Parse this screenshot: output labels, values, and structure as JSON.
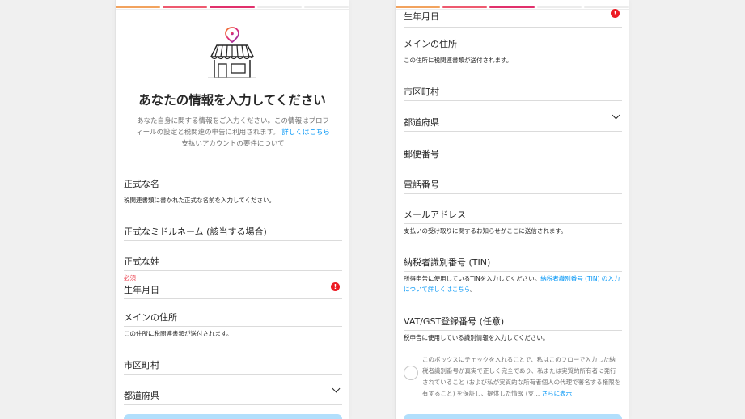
{
  "colors": {
    "progress": [
      "#f2a35e",
      "#ee5a6f",
      "#e1306c",
      "#ececec",
      "#ececec"
    ],
    "link": "#0095f6",
    "error": "#ed1c24",
    "button": "#b2dffc"
  },
  "left": {
    "title": "あなたの情報を入力してください",
    "intro": "あなた自身に関する情報をご入力ください。この情報はプロフィールの設定と税関連の申告に利用されます。",
    "intro_link": "詳しくはこちら",
    "intro_tail": " 支払いアカウントの要件について",
    "legal_first_name": "正式な名",
    "legal_first_name_help": "税関連書類に書かれた正式な名前を入力してください。",
    "middle_name": "正式なミドルネーム (該当する場合)",
    "last_name": "正式な姓",
    "required": "必須",
    "birthdate": "生年月日",
    "main_address": "メインの住所",
    "main_address_help": "この住所に税関連書類が送付されます。",
    "city": "市区町村",
    "prefecture": "都道府県"
  },
  "right": {
    "birthdate": "生年月日",
    "main_address": "メインの住所",
    "main_address_help": "この住所に税関連書類が送付されます。",
    "city": "市区町村",
    "prefecture": "都道府県",
    "postal": "郵便番号",
    "phone": "電話番号",
    "email": "メールアドレス",
    "email_help": "支払いの受け取りに関するお知らせがここに送信されます。",
    "tin": "納税者識別番号 (TIN)",
    "tin_help": "所得申告に使用しているTINを入力してください。",
    "tin_help_link": "納税者識別番号 (TIN) の入力について詳しくはこちら",
    "tin_help_end": "。",
    "vat": "VAT/GST登録番号 (任意)",
    "vat_help": "税申告に使用している識別情報を入力してください。",
    "consent": "このボックスにチェックを入れることで、私はこのフローで入力した納税者識別番号が真実で正しく完全であり、私または実質的所有者に発行されていること (および私が実質的な所有者個人の代理で署名する権限を有すること) を保証し、提供した情報 (支...",
    "consent_more": "さらに表示"
  }
}
